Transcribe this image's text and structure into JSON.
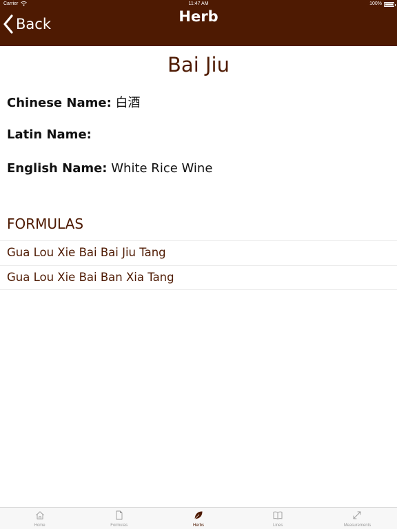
{
  "status_bar": {
    "carrier": "Carrier",
    "time": "11:47 AM",
    "battery": "100%"
  },
  "nav": {
    "back_label": "Back",
    "title": "Herb"
  },
  "herb": {
    "name": "Bai Jiu",
    "chinese_label": "Chinese Name:",
    "chinese_value": "白酒",
    "latin_label": "Latin Name:",
    "latin_value": "",
    "english_label": "English Name:",
    "english_value": "White Rice Wine"
  },
  "formulas": {
    "header": "FORMULAS",
    "items": [
      "Gua Lou Xie Bai Bai Jiu Tang",
      "Gua Lou Xie Bai Ban Xia Tang"
    ]
  },
  "tabs": [
    {
      "label": "Home",
      "icon": "home-icon"
    },
    {
      "label": "Formulas",
      "icon": "document-icon"
    },
    {
      "label": "Herbs",
      "icon": "leaf-icon",
      "active": true
    },
    {
      "label": "Lines",
      "icon": "book-icon"
    },
    {
      "label": "Measurements",
      "icon": "resize-icon"
    }
  ],
  "colors": {
    "brand": "#4e1a02",
    "tab_inactive": "#9a9a9a"
  }
}
